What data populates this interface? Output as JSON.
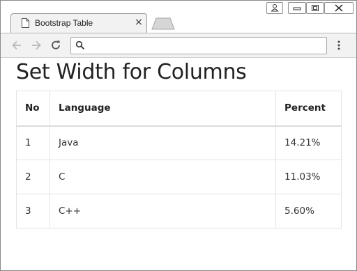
{
  "browser": {
    "tab_title": "Bootstrap Table",
    "tab_close_glyph": "×",
    "address_value": "",
    "icons": {
      "tab": "document-icon",
      "back": "arrow-left-icon",
      "forward": "arrow-right-icon",
      "reload": "reload-icon",
      "search": "search-icon",
      "menu": "three-dots-vertical-icon",
      "user": "user-icon",
      "minimize": "minimize-icon",
      "maximize": "maximize-icon",
      "close": "close-icon"
    }
  },
  "page": {
    "title": "Set Width for Columns",
    "table": {
      "headers": [
        "No",
        "Language",
        "Percent"
      ],
      "rows": [
        [
          "1",
          "Java",
          "14.21%"
        ],
        [
          "2",
          "C",
          "11.03%"
        ],
        [
          "3",
          "C++",
          "5.60%"
        ]
      ]
    }
  }
}
